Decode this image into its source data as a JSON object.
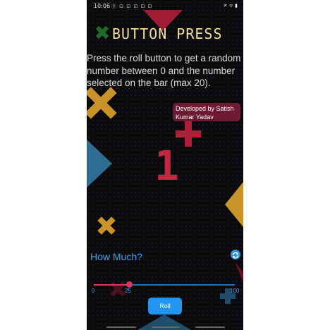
{
  "status_bar": {
    "time": "10:06",
    "notification_icons": [
      "ⓟ",
      "⊡",
      "⊡",
      "⊡",
      "⊡",
      "⊡"
    ],
    "right_icons": "✕ ᯤ ▮"
  },
  "app": {
    "title": "BUTTON PRESS",
    "description": "Press the roll button to get a random number between 0 and the number selected on the bar (max 20).",
    "credit": "Developed by Satish Kumar Yadav",
    "result": "1",
    "how_much_label": "How Much?",
    "refresh_icon": "refresh-icon"
  },
  "slider": {
    "min_label": "0",
    "value_label": "25",
    "max_label": "100",
    "fraction": 0.25
  },
  "roll_button": {
    "label": "Roll"
  },
  "colors": {
    "accent_blue": "#2196f3",
    "title_yellow": "#f3dd9b",
    "result_red": "#c2283f",
    "credit_bg": "#6d1a33"
  }
}
